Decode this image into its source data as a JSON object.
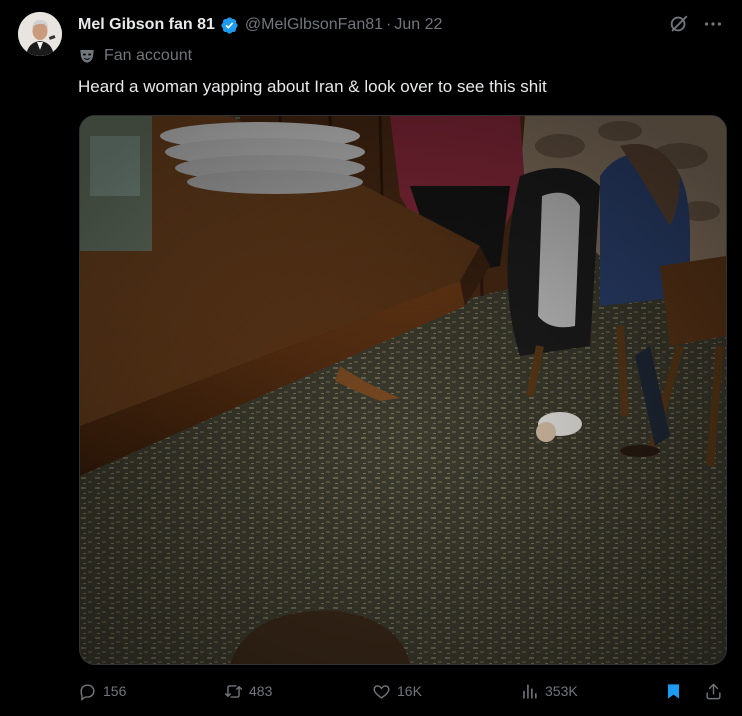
{
  "tweet": {
    "author_name": "Mel Gibson fan 81",
    "handle": "@MelGlbsonFan81",
    "separator": "·",
    "date": "Jun 22",
    "label": "Fan account",
    "text": "Heard a woman yapping about Iran & look over to see this shit"
  },
  "metrics": {
    "replies": "156",
    "reposts": "483",
    "likes": "16K",
    "views": "353K"
  },
  "colors": {
    "background": "#000000",
    "text_primary": "#e7e9ea",
    "text_secondary": "#71767b",
    "verified": "#1d9bf0",
    "bookmark": "#1d9bf0"
  },
  "icons": {
    "verified": "verified-badge-icon",
    "grok": "grok-icon",
    "more": "more-icon",
    "label": "mask-icon",
    "reply": "reply-icon",
    "repost": "repost-icon",
    "like": "heart-icon",
    "views": "views-icon",
    "bookmark": "bookmark-icon",
    "share": "share-icon"
  }
}
